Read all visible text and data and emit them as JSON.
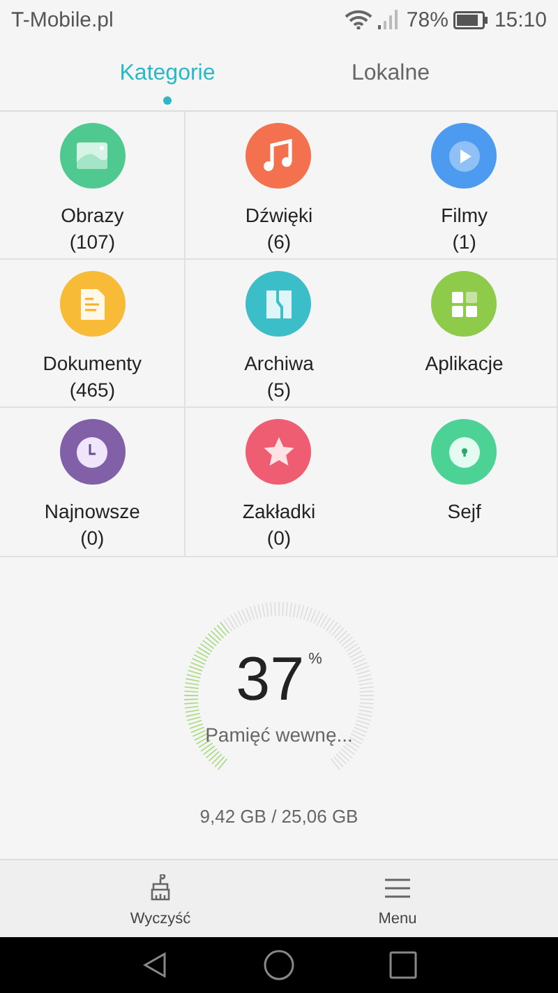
{
  "status_bar": {
    "carrier": "T-Mobile.pl",
    "battery": "78%",
    "time": "15:10"
  },
  "tabs": [
    {
      "label": "Kategorie",
      "selected": true
    },
    {
      "label": "Lokalne",
      "selected": false
    }
  ],
  "categories": [
    {
      "kind": "image",
      "label": "Obrazy",
      "count": "(107)",
      "color": "#4fc98f"
    },
    {
      "kind": "music",
      "label": "Dźwięki",
      "count": "(6)",
      "color": "#f4714f"
    },
    {
      "kind": "video",
      "label": "Filmy",
      "count": "(1)",
      "color": "#4d9bf0"
    },
    {
      "kind": "document",
      "label": "Dokumenty",
      "count": "(465)",
      "color": "#f7bb37"
    },
    {
      "kind": "archive",
      "label": "Archiwa",
      "count": "(5)",
      "color": "#3bbec8"
    },
    {
      "kind": "apps",
      "label": "Aplikacje",
      "color": "#8ecb4b"
    },
    {
      "kind": "clock",
      "label": "Najnowsze",
      "count": "(0)",
      "color": "#8160a8"
    },
    {
      "kind": "star",
      "label": "Zakładki",
      "count": "(0)",
      "color": "#ee5d71"
    },
    {
      "kind": "lock",
      "label": "Sejf",
      "color": "#4cd294"
    }
  ],
  "storage": {
    "percent": "37",
    "percent_sign": "%",
    "label": "Pamięć wewnę...",
    "usage": "9,42 GB / 25,06 GB"
  },
  "bottom_bar": [
    {
      "kind": "brush",
      "label": "Wyczyść"
    },
    {
      "kind": "menu",
      "label": "Menu"
    }
  ]
}
